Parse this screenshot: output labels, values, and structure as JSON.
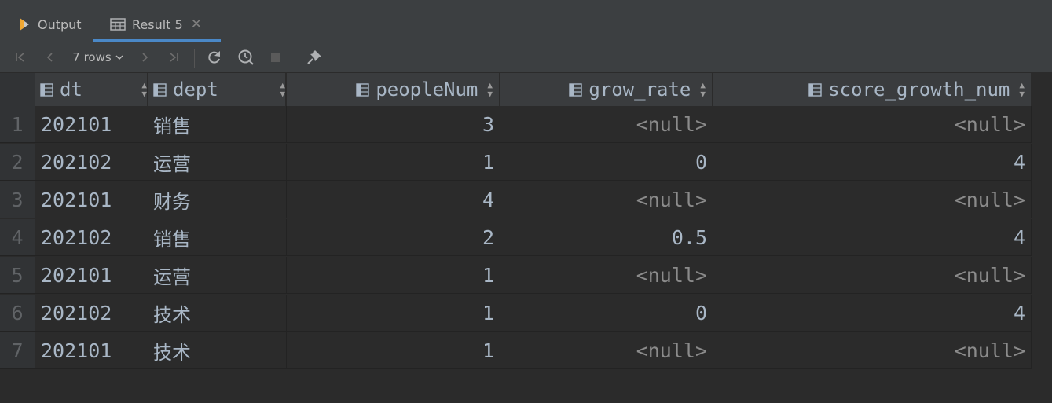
{
  "tabs": [
    {
      "label": "Output",
      "icon": "output-play-icon"
    },
    {
      "label": "Result 5",
      "icon": "table-icon",
      "close": "✕"
    }
  ],
  "toolbar": {
    "rows_label": "7 rows",
    "buttons": [
      "first-page",
      "prev-page",
      "next-page",
      "last-page",
      "reload",
      "query-history",
      "stop",
      "pin"
    ]
  },
  "grid": {
    "columns": [
      "dt",
      "dept",
      "peopleNum",
      "grow_rate",
      "score_growth_num"
    ],
    "rows": [
      {
        "n": "1",
        "dt": "202101",
        "dept": "销售",
        "peopleNum": "3",
        "grow_rate": "<null>",
        "score_growth_num": "<null>"
      },
      {
        "n": "2",
        "dt": "202102",
        "dept": "运营",
        "peopleNum": "1",
        "grow_rate": "0",
        "score_growth_num": "4"
      },
      {
        "n": "3",
        "dt": "202101",
        "dept": "财务",
        "peopleNum": "4",
        "grow_rate": "<null>",
        "score_growth_num": "<null>"
      },
      {
        "n": "4",
        "dt": "202102",
        "dept": "销售",
        "peopleNum": "2",
        "grow_rate": "0.5",
        "score_growth_num": "4"
      },
      {
        "n": "5",
        "dt": "202101",
        "dept": "运营",
        "peopleNum": "1",
        "grow_rate": "<null>",
        "score_growth_num": "<null>"
      },
      {
        "n": "6",
        "dt": "202102",
        "dept": "技术",
        "peopleNum": "1",
        "grow_rate": "0",
        "score_growth_num": "4"
      },
      {
        "n": "7",
        "dt": "202101",
        "dept": "技术",
        "peopleNum": "1",
        "grow_rate": "<null>",
        "score_growth_num": "<null>"
      }
    ]
  }
}
